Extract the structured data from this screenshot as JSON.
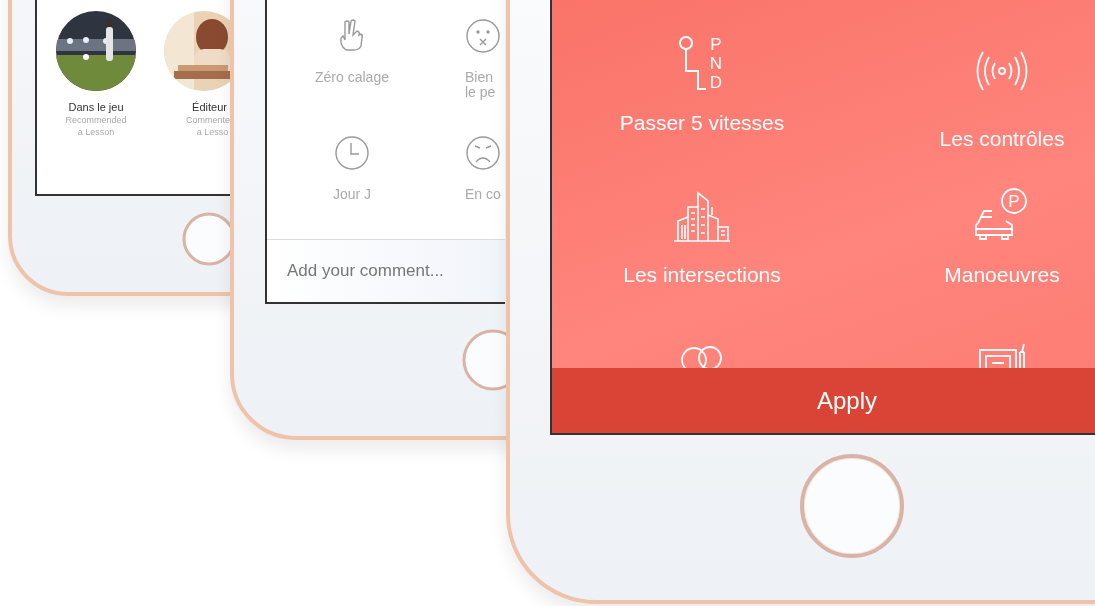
{
  "phones": [
    {
      "kind": "feed",
      "people": [
        {
          "name": "Dans le jeu",
          "lines": [
            "Recommended",
            "a Lesson"
          ]
        },
        {
          "name": "Éditeur",
          "lines": [
            "Commente",
            "a Lesso"
          ]
        }
      ]
    },
    {
      "kind": "reactions",
      "reactions": [
        {
          "kind": "hand",
          "label": [
            "Zéro calage"
          ]
        },
        {
          "kind": "dizzy",
          "label": [
            "Bien",
            "le pe"
          ]
        },
        {
          "kind": "clock",
          "label": [
            "Jour J"
          ]
        },
        {
          "kind": "angry",
          "label": [
            "En co"
          ]
        }
      ],
      "comment": {
        "placeholder": "Add your comment..."
      }
    },
    {
      "kind": "categories",
      "categories": [
        {
          "kind": "gearshift",
          "icon_text": [
            "P",
            "N",
            "D"
          ],
          "label": "Passer 5 vitesses"
        },
        {
          "kind": "signal",
          "label": "Les contrôles"
        },
        {
          "kind": "city",
          "label": "Les intersections"
        },
        {
          "kind": "parking",
          "icon_text": [
            "P"
          ],
          "label": "Manoeuvres"
        },
        {
          "kind": "circles"
        },
        {
          "kind": "radio"
        }
      ],
      "apply": "Apply"
    }
  ]
}
